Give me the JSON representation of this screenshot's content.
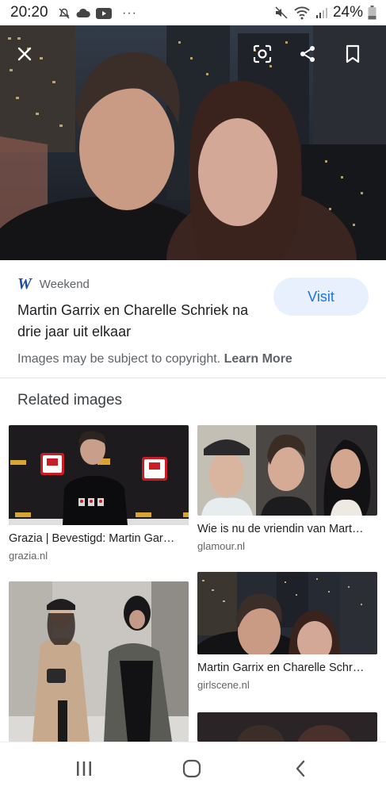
{
  "status_bar": {
    "time": "20:20",
    "battery": "24%",
    "more": "···"
  },
  "source": {
    "logo": "W",
    "name": "Weekend"
  },
  "article": {
    "title": "Martin Garrix en Charelle Schriek na drie jaar uit elkaar"
  },
  "visit_label": "Visit",
  "copyright": {
    "text": "Images may be subject to copyright.",
    "link": "Learn More"
  },
  "related": {
    "heading": "Related images",
    "items": [
      {
        "title": "Grazia | Bevestigd: Martin Gar…",
        "domain": "grazia.nl"
      },
      {
        "title": "Wie is nu de vriendin van Mart…",
        "domain": "glamour.nl"
      },
      {
        "title": "Martin Garrix en Charelle Schr…",
        "domain": "girlscene.nl"
      }
    ]
  },
  "icons": [
    "close-icon",
    "lens-icon",
    "share-icon",
    "bookmark-icon",
    "recents-icon",
    "home-icon",
    "back-icon"
  ]
}
